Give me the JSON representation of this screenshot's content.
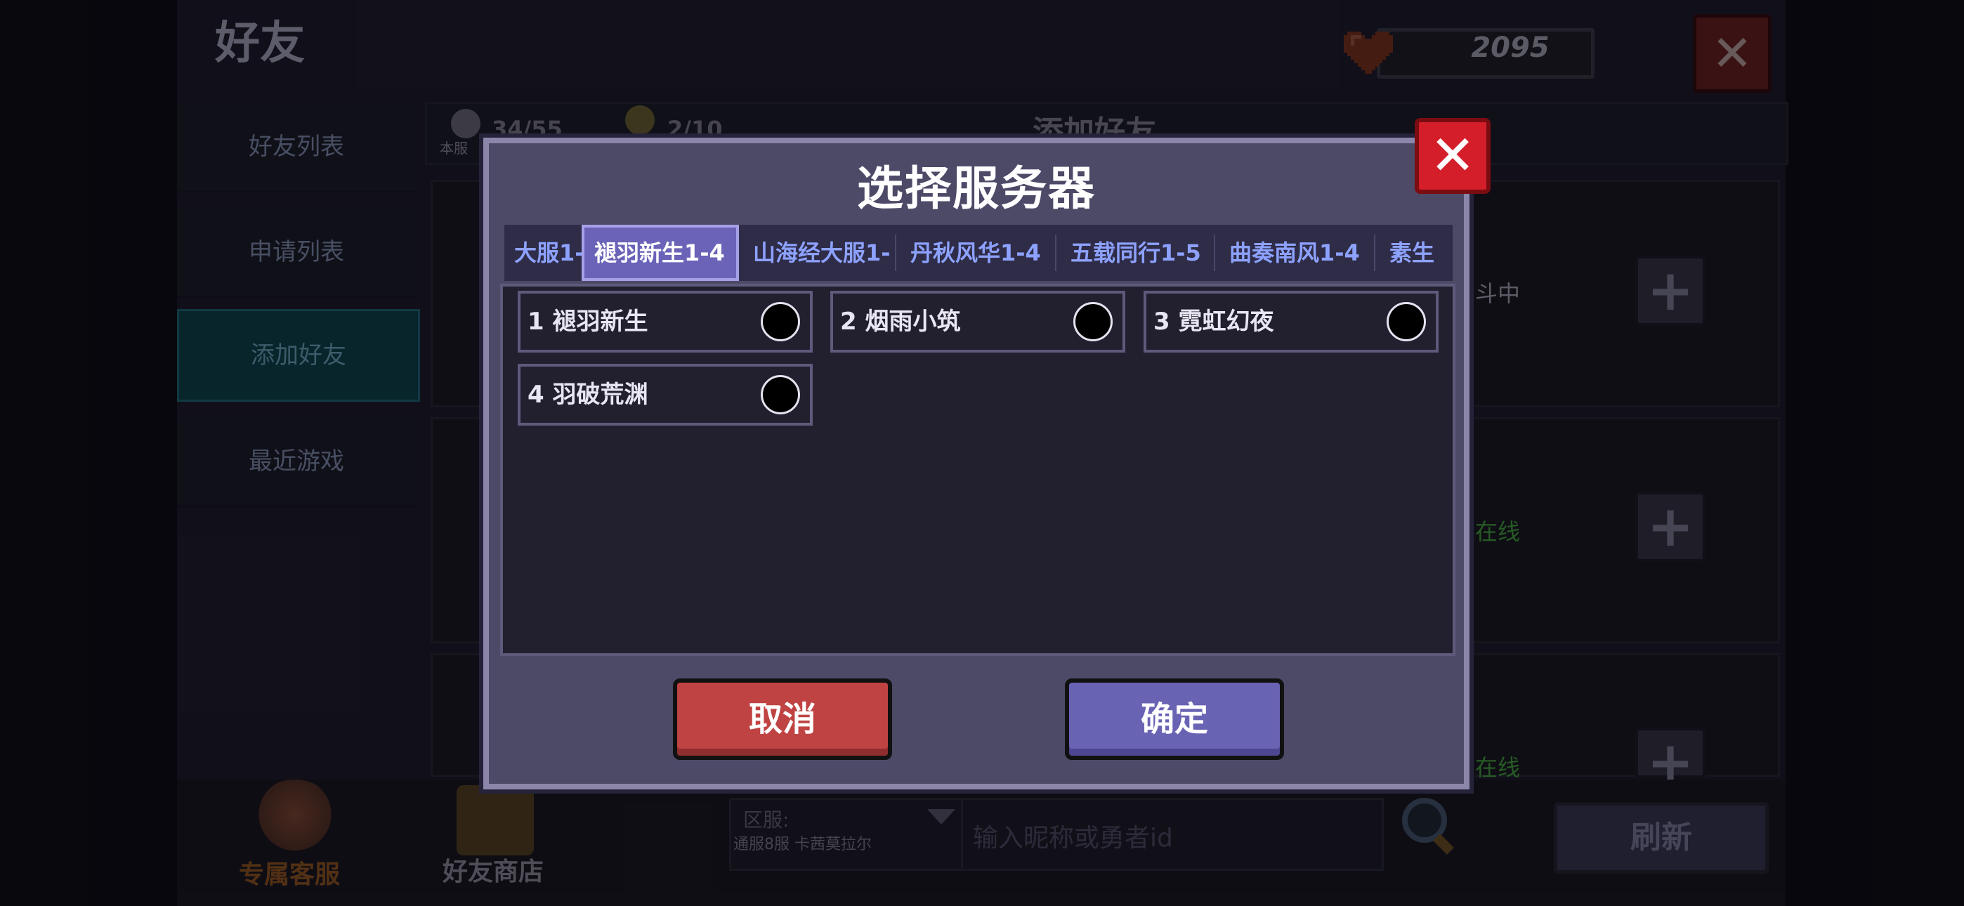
{
  "screen": {
    "title": "好友",
    "heart_count": "2095"
  },
  "sidebar": {
    "items": [
      {
        "label": "好友列表"
      },
      {
        "label": "申请列表"
      },
      {
        "label": "添加好友"
      },
      {
        "label": "最近游戏"
      }
    ],
    "active_index": 2
  },
  "content_header": {
    "count_server": "34/55",
    "count_server_label": "本服",
    "count_other": "2/10",
    "section_title": "添加好友"
  },
  "cards": [
    {
      "status": "斗中",
      "status_color": "#8e8d9e"
    },
    {
      "status": "在线",
      "status_color": "#3d8c3a"
    },
    {
      "status": "在线",
      "status_color": "#3d8c3a"
    }
  ],
  "bottom": {
    "service_label": "专属客服",
    "shop_label": "好友商店",
    "region_label": "区服:",
    "region_value": "通服8服 卡茜莫拉尔",
    "search_placeholder": "输入昵称或勇者id",
    "refresh_label": "刷新"
  },
  "modal": {
    "title": "选择服务器",
    "tabs": [
      {
        "label": "大服1-"
      },
      {
        "label": "褪羽新生1-4"
      },
      {
        "label": "山海经大服1-"
      },
      {
        "label": "丹秋风华1-4"
      },
      {
        "label": "五载同行1-5"
      },
      {
        "label": "曲奏南风1-4"
      },
      {
        "label": "素生"
      }
    ],
    "active_tab": 1,
    "servers": [
      {
        "label": "1 褪羽新生",
        "selected": false
      },
      {
        "label": "2 烟雨小筑",
        "selected": false
      },
      {
        "label": "3 霓虹幻夜",
        "selected": false
      },
      {
        "label": "4 羽破荒渊",
        "selected": false
      }
    ],
    "cancel_label": "取消",
    "confirm_label": "确定"
  },
  "colors": {
    "modal_bg": "#4d4a68",
    "tab_text": "#8da2ff",
    "tab_active_bg": "#6a63b8",
    "cancel_bg": "#c04343",
    "confirm_bg": "#6963b4",
    "close_bg": "#d41f2b"
  }
}
